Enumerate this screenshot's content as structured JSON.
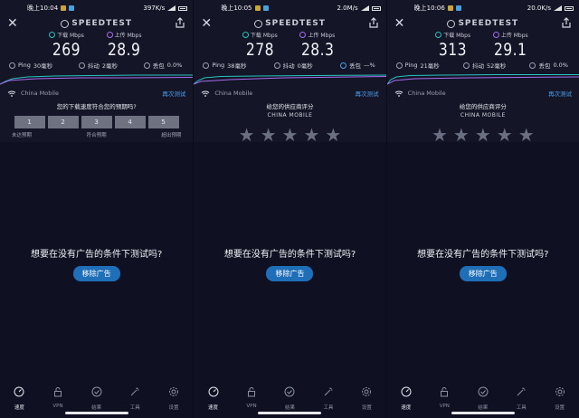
{
  "app": {
    "brand": "SPEEDTEST"
  },
  "panels": [
    {
      "status": {
        "time": "晚上10:04",
        "net": "397K/s"
      },
      "download": {
        "label": "下载 Mbps",
        "value": "269"
      },
      "upload": {
        "label": "上传 Mbps",
        "value": "28.9"
      },
      "ping": {
        "label": "Ping",
        "value": "30毫秒"
      },
      "jitter": {
        "label": "抖动",
        "value": "2毫秒"
      },
      "loss": {
        "label": "丢包",
        "value": "0.0%"
      },
      "network": "China Mobile",
      "retest": "再次测试",
      "rating": {
        "question": "您的下载速度符合您的预期吗?",
        "options": [
          "1",
          "2",
          "3",
          "4",
          "5"
        ],
        "low": "未达预期",
        "mid": "符合预期",
        "high": "超出预期"
      },
      "ad": {
        "question": "想要在没有广告的条件下测试吗?",
        "button": "移除广告"
      }
    },
    {
      "status": {
        "time": "晚上10:05",
        "net": "2.0M/s"
      },
      "download": {
        "label": "下载 Mbps",
        "value": "278"
      },
      "upload": {
        "label": "上传 Mbps",
        "value": "28.3"
      },
      "ping": {
        "label": "Ping",
        "value": "38毫秒"
      },
      "jitter": {
        "label": "抖动",
        "value": "0毫秒"
      },
      "loss": {
        "label": "丢包",
        "value": "—%"
      },
      "network": "China Mobile",
      "retest": "再次测试",
      "rating": {
        "question": "给您的供应商评分",
        "provider": "CHINA MOBILE"
      },
      "ad": {
        "question": "想要在没有广告的条件下测试吗?",
        "button": "移除广告"
      }
    },
    {
      "status": {
        "time": "晚上10:06",
        "net": "20.0K/s"
      },
      "download": {
        "label": "下载 Mbps",
        "value": "313"
      },
      "upload": {
        "label": "上传 Mbps",
        "value": "29.1"
      },
      "ping": {
        "label": "Ping",
        "value": "21毫秒"
      },
      "jitter": {
        "label": "抖动",
        "value": "52毫秒"
      },
      "loss": {
        "label": "丢包",
        "value": "0.0%"
      },
      "network": "China Mobile",
      "retest": "再次测试",
      "rating": {
        "question": "给您的供应商评分",
        "provider": "CHINA MOBILE"
      },
      "ad": {
        "question": "想要在没有广告的条件下测试吗?",
        "button": "移除广告"
      }
    }
  ],
  "nav": [
    "速度",
    "VPN",
    "结果",
    "工具",
    "设置"
  ],
  "colors": {
    "accent": "#4da0f0",
    "download": "#28c3c0",
    "upload": "#a86cf0",
    "bg": "#141526",
    "button": "#1f6fb8"
  }
}
